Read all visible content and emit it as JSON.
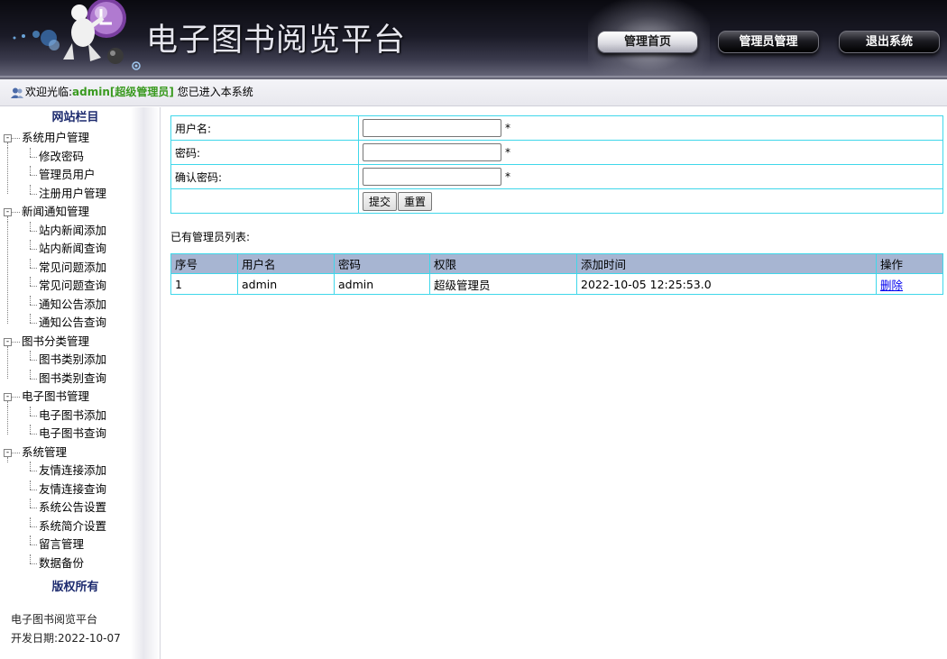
{
  "header": {
    "site_title": "电子图书阅览平台",
    "nav": [
      {
        "label": "管理首页",
        "active": true
      },
      {
        "label": "管理员管理",
        "active": false
      },
      {
        "label": "退出系统",
        "active": false
      }
    ]
  },
  "welcome": {
    "prefix": "欢迎光临:",
    "username": "admin[超级管理员]",
    "suffix": " 您已进入本系统"
  },
  "sidebar": {
    "heading": "网站栏目",
    "groups": [
      {
        "label": "系统用户管理",
        "items": [
          "修改密码",
          "管理员用户",
          "注册用户管理"
        ]
      },
      {
        "label": "新闻通知管理",
        "items": [
          "站内新闻添加",
          "站内新闻查询",
          "常见问题添加",
          "常见问题查询",
          "通知公告添加",
          "通知公告查询"
        ]
      },
      {
        "label": "图书分类管理",
        "items": [
          "图书类别添加",
          "图书类别查询"
        ]
      },
      {
        "label": "电子图书管理",
        "items": [
          "电子图书添加",
          "电子图书查询"
        ]
      },
      {
        "label": "系统管理",
        "items": [
          "友情连接添加",
          "友情连接查询",
          "系统公告设置",
          "系统简介设置",
          "留言管理",
          "数据备份"
        ]
      }
    ],
    "copyright_title": "版权所有",
    "footer_platform": "电子图书阅览平台",
    "footer_date": "开发日期:2022-10-07"
  },
  "form": {
    "username_label": "用户名:",
    "password_label": "密码:",
    "confirm_label": "确认密码:",
    "required_mark": "*",
    "username_value": "",
    "password_value": "",
    "confirm_value": "",
    "submit_label": "提交",
    "reset_label": "重置"
  },
  "admin_list": {
    "title": "已有管理员列表:",
    "columns": [
      "序号",
      "用户名",
      "密码",
      "权限",
      "添加时间",
      "操作"
    ],
    "rows": [
      {
        "index": "1",
        "username": "admin",
        "password": "admin",
        "role": "超级管理员",
        "added": "2022-10-05 12:25:53.0",
        "action": "删除"
      }
    ]
  },
  "colors": {
    "table_border": "#3fd7ea",
    "table_header_bg": "#a7b5d2",
    "username_accent": "#3a9a20",
    "sidebar_heading": "#1c2a6e",
    "link": "#0000ee"
  }
}
